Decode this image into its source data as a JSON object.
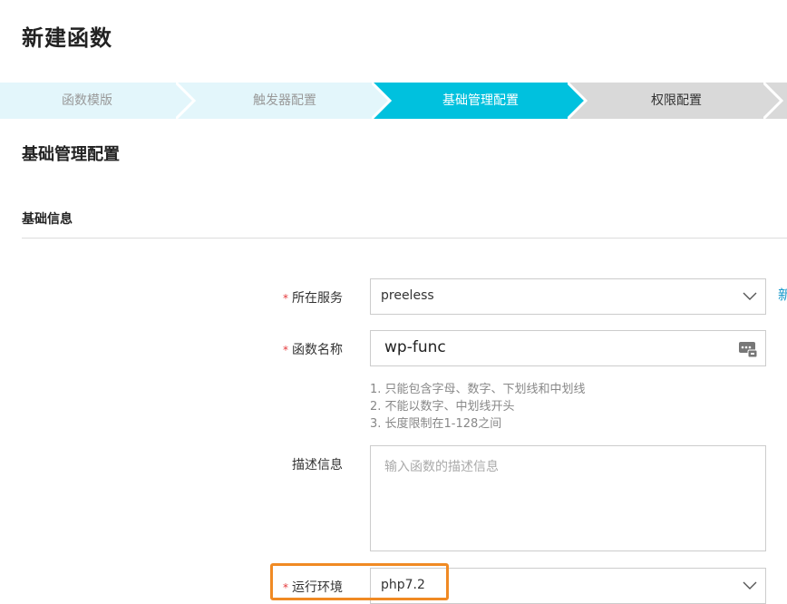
{
  "page": {
    "title": "新建函数"
  },
  "stepper": {
    "steps": [
      {
        "label": "函数模版",
        "state": "done"
      },
      {
        "label": "触发器配置",
        "state": "done"
      },
      {
        "label": "基础管理配置",
        "state": "active"
      },
      {
        "label": "权限配置",
        "state": "pending"
      }
    ],
    "colors": {
      "done": "#e3f6fb",
      "active": "#00c1de",
      "pending": "#d9d9d9"
    }
  },
  "section": {
    "title": "基础管理配置",
    "subtitle": "基础信息"
  },
  "form": {
    "service": {
      "label": "所在服务",
      "required": true,
      "value": "preeless",
      "side_link": "新"
    },
    "function_name": {
      "label": "函数名称",
      "required": true,
      "value": "wp-func",
      "hints": [
        "1. 只能包含字母、数字、下划线和中划线",
        "2. 不能以数字、中划线开头",
        "3. 长度限制在1-128之间"
      ]
    },
    "description": {
      "label": "描述信息",
      "required": false,
      "placeholder": "输入函数的描述信息"
    },
    "runtime": {
      "label": "运行环境",
      "required": true,
      "value": "php7.2"
    }
  },
  "required_mark": "*",
  "highlight_color": "#f08a24"
}
